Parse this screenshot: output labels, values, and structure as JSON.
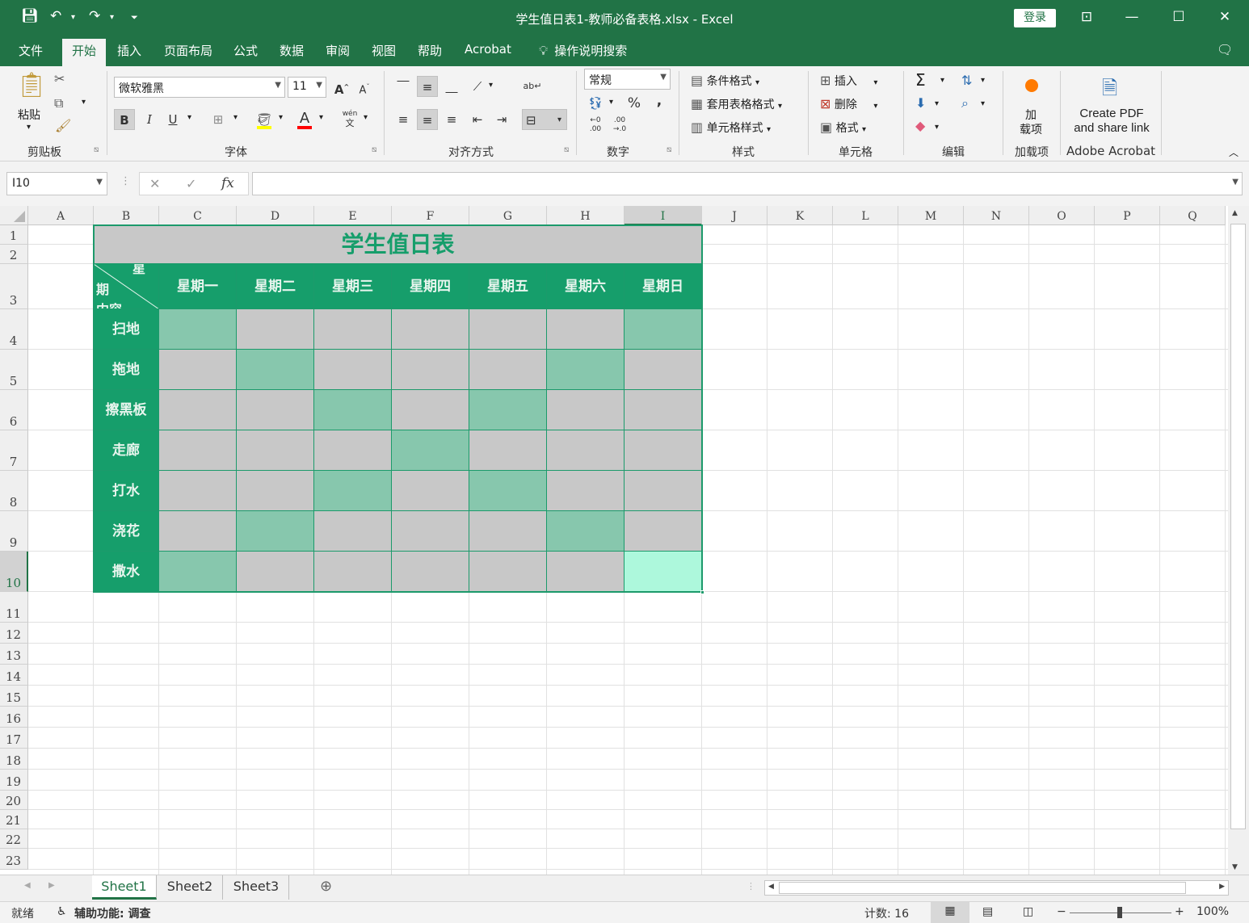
{
  "window": {
    "title": "学生值日表1-教师必备表格.xlsx  -  Excel",
    "login": "登录"
  },
  "menu": {
    "items": [
      "文件",
      "开始",
      "插入",
      "页面布局",
      "公式",
      "数据",
      "审阅",
      "视图",
      "帮助",
      "Acrobat"
    ],
    "active": "开始",
    "tell_me": "操作说明搜索"
  },
  "ribbon": {
    "clipboard": {
      "paste": "粘贴",
      "label": "剪贴板"
    },
    "font": {
      "name": "微软雅黑",
      "size": "11",
      "label": "字体",
      "bold": "B",
      "italic": "I",
      "underline": "U",
      "grow": "A",
      "shrink": "A",
      "font_color": "A",
      "phonetic": "wén",
      "phonetic2": "文"
    },
    "alignment": {
      "label": "对齐方式"
    },
    "number": {
      "format": "常规",
      "label": "数字",
      "percent": "%",
      "comma": ","
    },
    "styles": {
      "conditional": "条件格式",
      "table": "套用表格格式",
      "cell_styles": "单元格样式",
      "label": "样式"
    },
    "cells": {
      "insert": "插入",
      "delete": "删除",
      "format": "格式",
      "label": "单元格"
    },
    "editing": {
      "label": "编辑",
      "sum": "Σ"
    },
    "addins": {
      "line1": "加",
      "line2": "载项",
      "label": "加载项"
    },
    "acrobat": {
      "line1": "Create PDF",
      "line2": "and share link",
      "label": "Adobe Acrobat"
    }
  },
  "formula_bar": {
    "name_box": "I10",
    "cancel": "✕",
    "enter": "✓",
    "fx": "fx",
    "content": ""
  },
  "columns": [
    "A",
    "B",
    "C",
    "D",
    "E",
    "F",
    "G",
    "H",
    "I",
    "J",
    "K",
    "L",
    "M",
    "N",
    "O",
    "P",
    "Q"
  ],
  "rows": [
    "1",
    "2",
    "3",
    "4",
    "5",
    "6",
    "7",
    "8",
    "9",
    "10",
    "11",
    "12",
    "13",
    "14",
    "15",
    "16",
    "17",
    "18",
    "19",
    "20",
    "21",
    "22",
    "23"
  ],
  "selected": {
    "column": "I",
    "row": "10"
  },
  "table": {
    "title": "学生值日表",
    "corner_top": "星",
    "corner_mid": "期",
    "corner_bottom": "内容",
    "days": [
      "星期一",
      "星期二",
      "星期三",
      "星期四",
      "星期五",
      "星期六",
      "星期日"
    ],
    "tasks": [
      {
        "name": "扫地",
        "fills": [
          "mint",
          "gray",
          "gray",
          "gray",
          "gray",
          "gray",
          "mint"
        ]
      },
      {
        "name": "拖地",
        "fills": [
          "gray",
          "mint",
          "gray",
          "gray",
          "gray",
          "mint",
          "gray"
        ]
      },
      {
        "name": "擦黑板",
        "fills": [
          "gray",
          "gray",
          "mint",
          "gray",
          "mint",
          "gray",
          "gray"
        ]
      },
      {
        "name": "走廊",
        "fills": [
          "gray",
          "gray",
          "gray",
          "mint",
          "gray",
          "gray",
          "gray"
        ]
      },
      {
        "name": "打水",
        "fills": [
          "gray",
          "gray",
          "mint",
          "gray",
          "mint",
          "gray",
          "gray"
        ]
      },
      {
        "name": "浇花",
        "fills": [
          "gray",
          "mint",
          "gray",
          "gray",
          "gray",
          "mint",
          "gray"
        ]
      },
      {
        "name": "撒水",
        "fills": [
          "mint",
          "gray",
          "gray",
          "gray",
          "gray",
          "gray",
          "selected"
        ]
      }
    ],
    "colors": {
      "header_green": "#169e6b",
      "gray": "#c8c8c8",
      "mint": "#87c7ad",
      "selected": "#adf8dc"
    }
  },
  "sheets": [
    "Sheet1",
    "Sheet2",
    "Sheet3"
  ],
  "active_sheet": "Sheet1",
  "status": {
    "ready": "就绪",
    "accessibility": "辅助功能: 调查",
    "count": "计数: 16",
    "zoom": "100%"
  },
  "colors": {
    "brand": "#217346"
  }
}
